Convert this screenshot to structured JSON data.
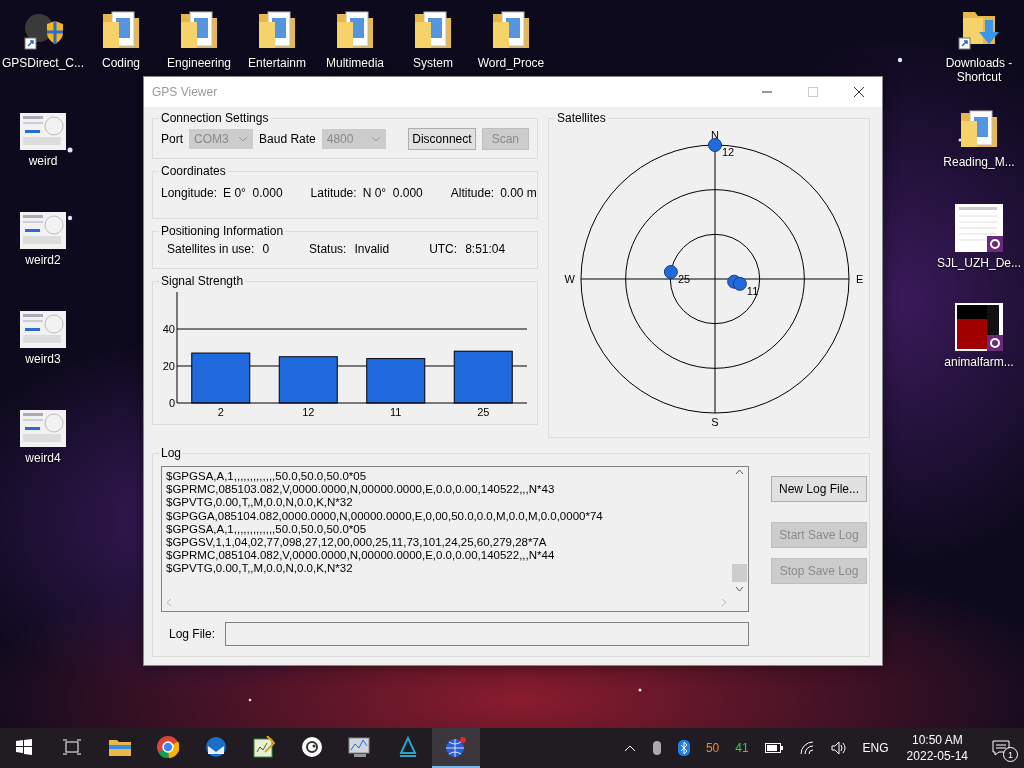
{
  "desktop": {
    "top_row": [
      {
        "label": "GPSDirect_C...",
        "kind": "app-shortcut"
      },
      {
        "label": "Coding",
        "kind": "folder"
      },
      {
        "label": "Engineering",
        "kind": "folder"
      },
      {
        "label": "Entertainm",
        "kind": "folder"
      },
      {
        "label": "Multimedia",
        "kind": "folder"
      },
      {
        "label": "System",
        "kind": "folder"
      },
      {
        "label": "Word_Proce",
        "kind": "folder"
      }
    ],
    "left_column": [
      {
        "label": "weird",
        "kind": "screenshot"
      },
      {
        "label": "weird2",
        "kind": "screenshot"
      },
      {
        "label": "weird3",
        "kind": "screenshot"
      },
      {
        "label": "weird4",
        "kind": "screenshot"
      }
    ],
    "right_column": [
      {
        "label": "Downloads - Shortcut",
        "kind": "download-shortcut"
      },
      {
        "label": "Reading_M...",
        "kind": "folder"
      },
      {
        "label": "SJL_UZH_De...",
        "kind": "document"
      },
      {
        "label": "animalfarm...",
        "kind": "book"
      }
    ]
  },
  "window": {
    "title": "GPS Viewer",
    "connection": {
      "title": "Connection Settings",
      "port_label": "Port",
      "port": {
        "value": "COM3",
        "disabled": true
      },
      "baud_label": "Baud Rate",
      "baud": {
        "value": "4800",
        "disabled": true
      },
      "buttons": [
        {
          "label": "Disconnect",
          "disabled": false
        },
        {
          "label": "Scan",
          "disabled": true
        }
      ]
    },
    "coordinates": {
      "title": "Coordinates",
      "fields": [
        {
          "label": "Longitude:",
          "value": "E 0°  0.000"
        },
        {
          "label": "Latitude:",
          "value": "N 0°  0.000"
        },
        {
          "label": "Altitude:",
          "value": "0.00 m"
        }
      ]
    },
    "positioning": {
      "title": "Positioning Information",
      "fields": [
        {
          "label": "Satellites in use:",
          "value": "0"
        },
        {
          "label": "Status:",
          "value": "Invalid"
        },
        {
          "label": "UTC:",
          "value": "8:51:04"
        }
      ]
    },
    "signal": {
      "title": "Signal Strength",
      "chart_data": {
        "type": "bar",
        "categories": [
          "2",
          "12",
          "11",
          "25"
        ],
        "values": [
          27,
          25,
          24,
          28
        ],
        "ylim": [
          0,
          60
        ],
        "yticks": [
          0,
          20,
          40
        ]
      }
    },
    "satellites": {
      "title": "Satellites",
      "compass": [
        "N",
        "E",
        "S",
        "W"
      ],
      "dot_labels": [
        "12",
        "11",
        "25"
      ]
    },
    "log": {
      "title": "Log",
      "lines": [
        "$GPGSA,A,1,,,,,,,,,,,,,50.0,50.0,50.0*05",
        "$GPRMC,085103.082,V,0000.0000,N,00000.0000,E,0.0,0.00,140522,,,N*43",
        "$GPVTG,0.00,T,,M,0.0,N,0.0,K,N*32",
        "$GPGGA,085104.082,0000.0000,N,00000.0000,E,0,00,50.0,0.0,M,0.0,M,0.0,0000*74",
        "$GPGSA,A,1,,,,,,,,,,,,,50.0,50.0,50.0*05",
        "$GPGSV,1,1,04,02,77,098,27,12,00,000,25,11,73,101,24,25,60,279,28*7A",
        "$GPRMC,085104.082,V,0000.0000,N,00000.0000,E,0.0,0.00,140522,,,N*44",
        "$GPVTG,0.00,T,,M,0.0,N,0.0,K,N*32"
      ],
      "file_label": "Log File:",
      "buttons": [
        {
          "label": "New Log File...",
          "disabled": false
        },
        {
          "label": "Start Save Log",
          "disabled": true
        },
        {
          "label": "Stop Save Log",
          "disabled": true
        }
      ]
    }
  },
  "taskbar": {
    "apps": [
      {
        "selected": false
      },
      {
        "selected": false
      },
      {
        "selected": false
      },
      {
        "selected": false
      },
      {
        "selected": false
      },
      {
        "selected": false
      },
      {
        "selected": false
      },
      {
        "selected": true
      }
    ],
    "tray_readings": [
      {
        "text": "50",
        "color": "#f08c28"
      },
      {
        "text": "41",
        "color": "#3cd23c"
      }
    ],
    "language": "ENG",
    "time": "10:50 AM",
    "date": "2022-05-14",
    "notifications": "1"
  }
}
